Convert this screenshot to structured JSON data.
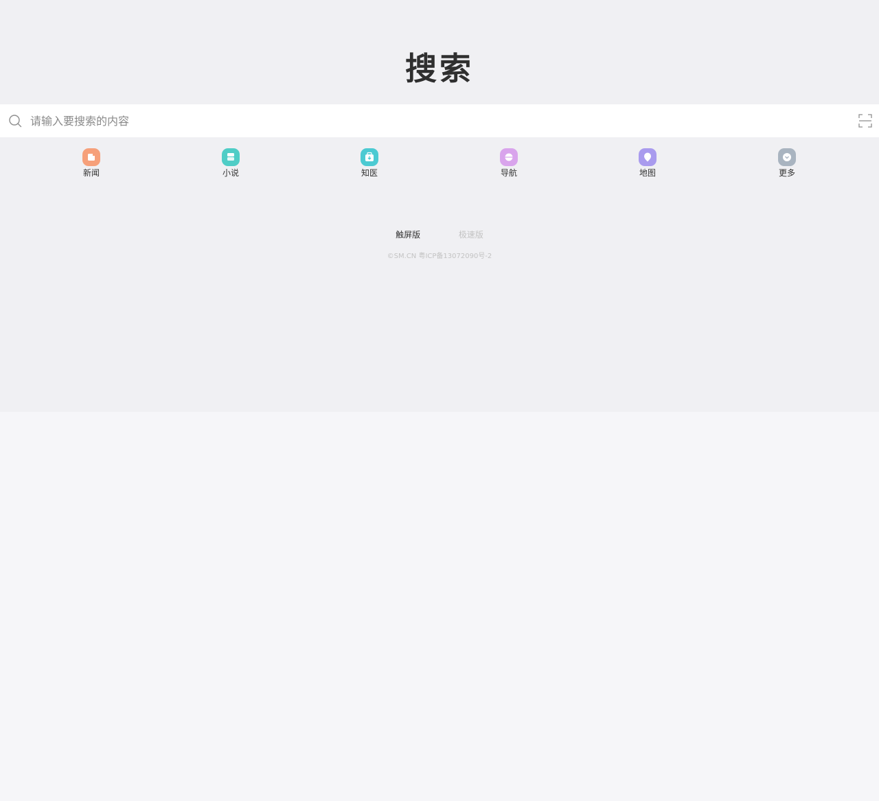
{
  "header": {
    "logo_text": "搜索"
  },
  "search": {
    "placeholder": "请输入要搜索的内容",
    "value": ""
  },
  "nav": {
    "items": [
      {
        "label": "新闻",
        "icon": "news-icon",
        "color": "#f6a07a"
      },
      {
        "label": "小说",
        "icon": "book-icon",
        "color": "#4fcdc6"
      },
      {
        "label": "知医",
        "icon": "medical-icon",
        "color": "#4ccad2"
      },
      {
        "label": "导航",
        "icon": "compass-icon",
        "color": "#d9a4ec"
      },
      {
        "label": "地图",
        "icon": "map-pin-icon",
        "color": "#a99bee"
      },
      {
        "label": "更多",
        "icon": "more-icon",
        "color": "#a9b4c0"
      }
    ]
  },
  "footer": {
    "versions": [
      {
        "label": "触屏版",
        "active": true
      },
      {
        "label": "极速版",
        "active": false
      }
    ],
    "copyright": "©SM.CN 粤ICP备13072090号-2"
  }
}
